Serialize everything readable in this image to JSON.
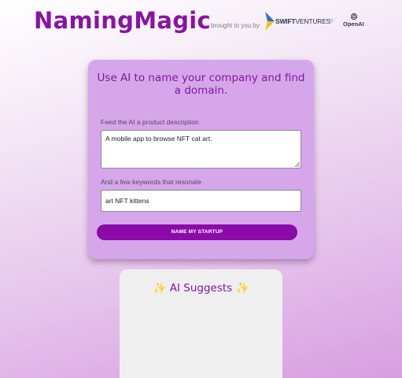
{
  "header": {
    "logo": "NamingMagic",
    "brought_by": "brought to you by",
    "sponsor1_strong": "SWIFT",
    "sponsor1_rest": "VENTURES",
    "plus": "+",
    "sponsor2": "OpenAI"
  },
  "form": {
    "title": "Use AI to name your company and find a domain.",
    "description_label": "Feed the AI a product description",
    "description_value": "A mobile app to browse NFT cat art.",
    "keywords_label": "And a few keywords that resonate",
    "keywords_value": "art NFT kittens",
    "submit_label": "NAME MY STARTUP"
  },
  "suggestions": {
    "sparkle_left": "✨",
    "title": "AI Suggests",
    "sparkle_right": "✨"
  },
  "colors": {
    "brand": "#8a13a3",
    "button": "#8b0aa8",
    "card": "#d6a6ea"
  }
}
